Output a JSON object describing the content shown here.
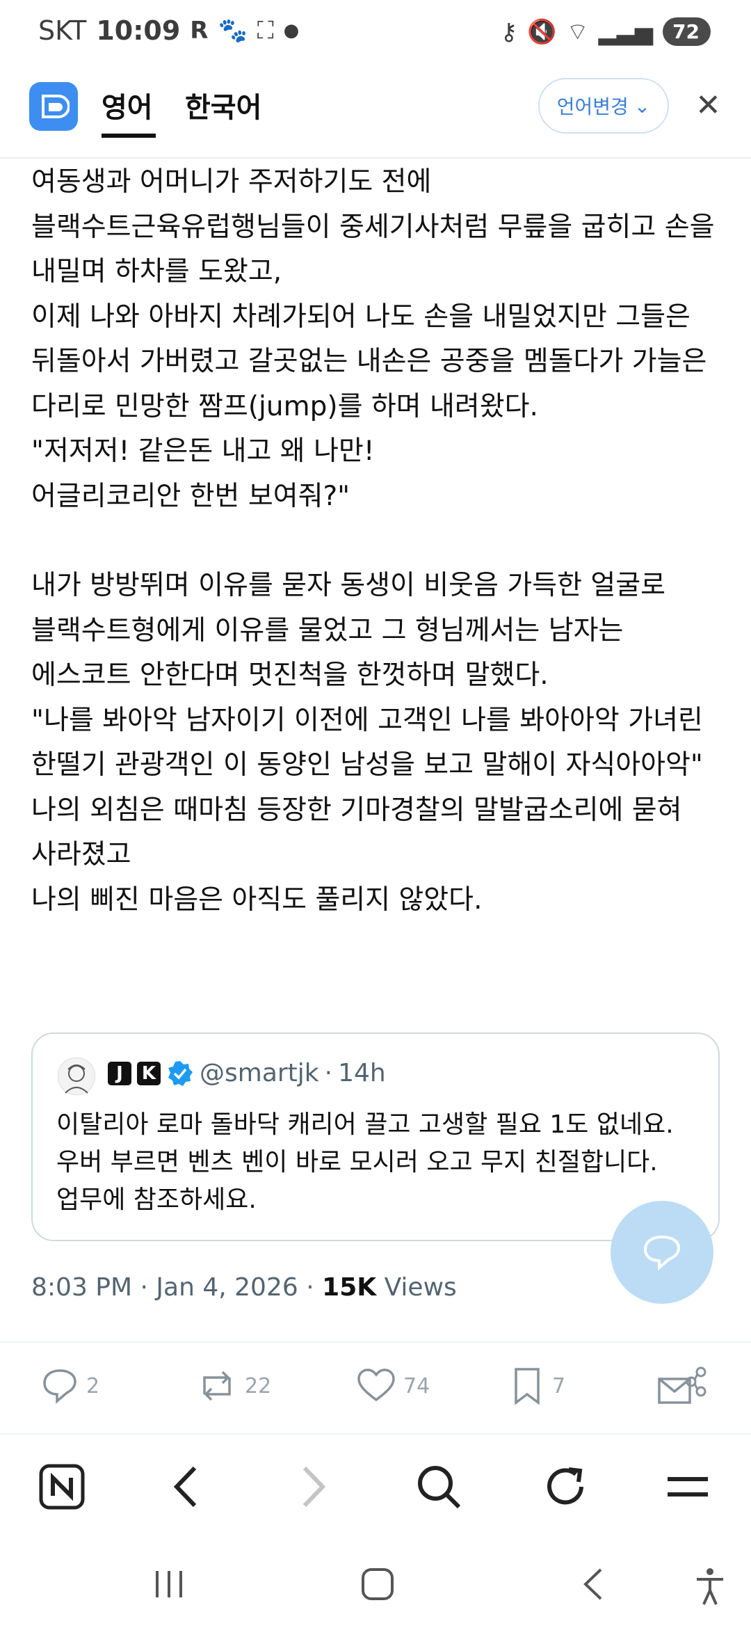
{
  "status_bar": {
    "carrier": "SKT",
    "time": "10:09",
    "battery": "72"
  },
  "translate_header": {
    "tab_source": "영어",
    "tab_target": "한국어",
    "change_lang": "언어변경"
  },
  "article": {
    "paragraphs": [
      "여동생과 어머니가 주저하기도 전에 블랙수트근육유럽행님들이 중세기사처럼 무릎을 굽히고 손을 내밀며 하차를 도왔고,",
      "이제 나와 아바지 차례가되어 나도 손을 내밀었지만 그들은 뒤돌아서 가버렸고 갈곳없는 내손은 공중을 멤돌다가 가늘은 다리로 민망한 짬프(jump)를 하며 내려왔다.",
      "\"저저저! 같은돈 내고 왜 나만!",
      "어글리코리안 한번 보여줘?\"",
      "내가 방방뛰며 이유를 묻자 동생이 비웃음 가득한 얼굴로  블랙수트형에게 이유를 물었고 그 형님께서는 남자는 에스코트 안한다며 멋진척을 한껏하며 말했다.",
      "\"나를 봐아악 남자이기 이전에 고객인 나를 봐아아악 가녀린 한떨기 관광객인 이 동양인 남성을 보고 말해이 자식아아악\"",
      "나의 외침은 때마침 등장한 기마경찰의 말발굽소리에 묻혀 사라졌고",
      "나의 삐진 마음은 아직도 풀리지 않았다."
    ]
  },
  "quote": {
    "badge1": "J",
    "badge2": "K",
    "handle": "@smartjk",
    "sep": "·",
    "age": "14h",
    "text": "이탈리아 로마 돌바닥 캐리어 끌고 고생할 필요 1도 없네요. 우버 부르면 벤츠 벤이 바로 모시러 오고 무지 친절합니다. 업무에 참조하세요."
  },
  "meta": {
    "time": "8:03 PM",
    "sep1": "·",
    "date": "Jan 4, 2026",
    "sep2": "·",
    "views_count": "15K",
    "views_label": "Views"
  },
  "actions": {
    "replies": "2",
    "reposts": "22",
    "likes": "74",
    "bookmarks": "7"
  }
}
